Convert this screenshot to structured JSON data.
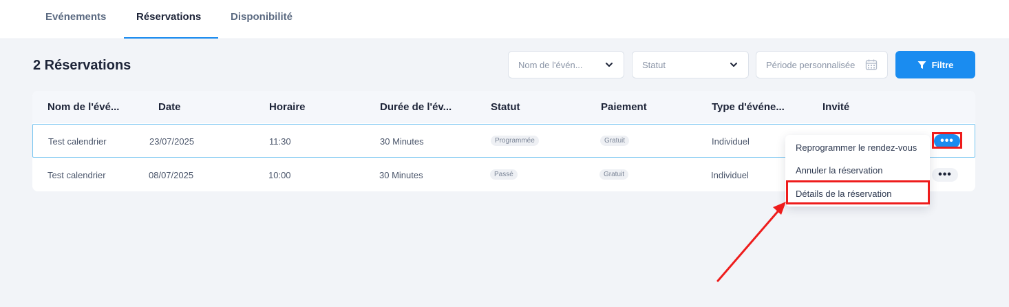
{
  "tabs": [
    {
      "label": "Evénements"
    },
    {
      "label": "Réservations",
      "active": true
    },
    {
      "label": "Disponibilité"
    }
  ],
  "title": "2 Réservations",
  "filters": {
    "event_name_placeholder": "Nom de l'évén...",
    "status_placeholder": "Statut",
    "period_placeholder": "Période personnalisée",
    "filter_button": "Filtre"
  },
  "table": {
    "headers": [
      "Nom de l'évé...",
      "Date",
      "Horaire",
      "Durée de l'év...",
      "Statut",
      "Paiement",
      "Type d'événe...",
      "Invité"
    ],
    "rows": [
      {
        "name": "Test calendrier",
        "date": "23/07/2025",
        "time": "11:30",
        "duration": "30 Minutes",
        "status": "Programmée",
        "payment": "Gratuit",
        "type": "Individuel"
      },
      {
        "name": "Test calendrier",
        "date": "08/07/2025",
        "time": "10:00",
        "duration": "30 Minutes",
        "status": "Passé",
        "payment": "Gratuit",
        "type": "Individuel"
      }
    ],
    "more_glyph": "•••"
  },
  "menu": {
    "items": [
      "Reprogrammer le rendez-vous",
      "Annuler la réservation",
      "Détails de la réservation"
    ]
  },
  "colors": {
    "accent": "#1a8cf0",
    "annotation": "#ee1c1c"
  }
}
